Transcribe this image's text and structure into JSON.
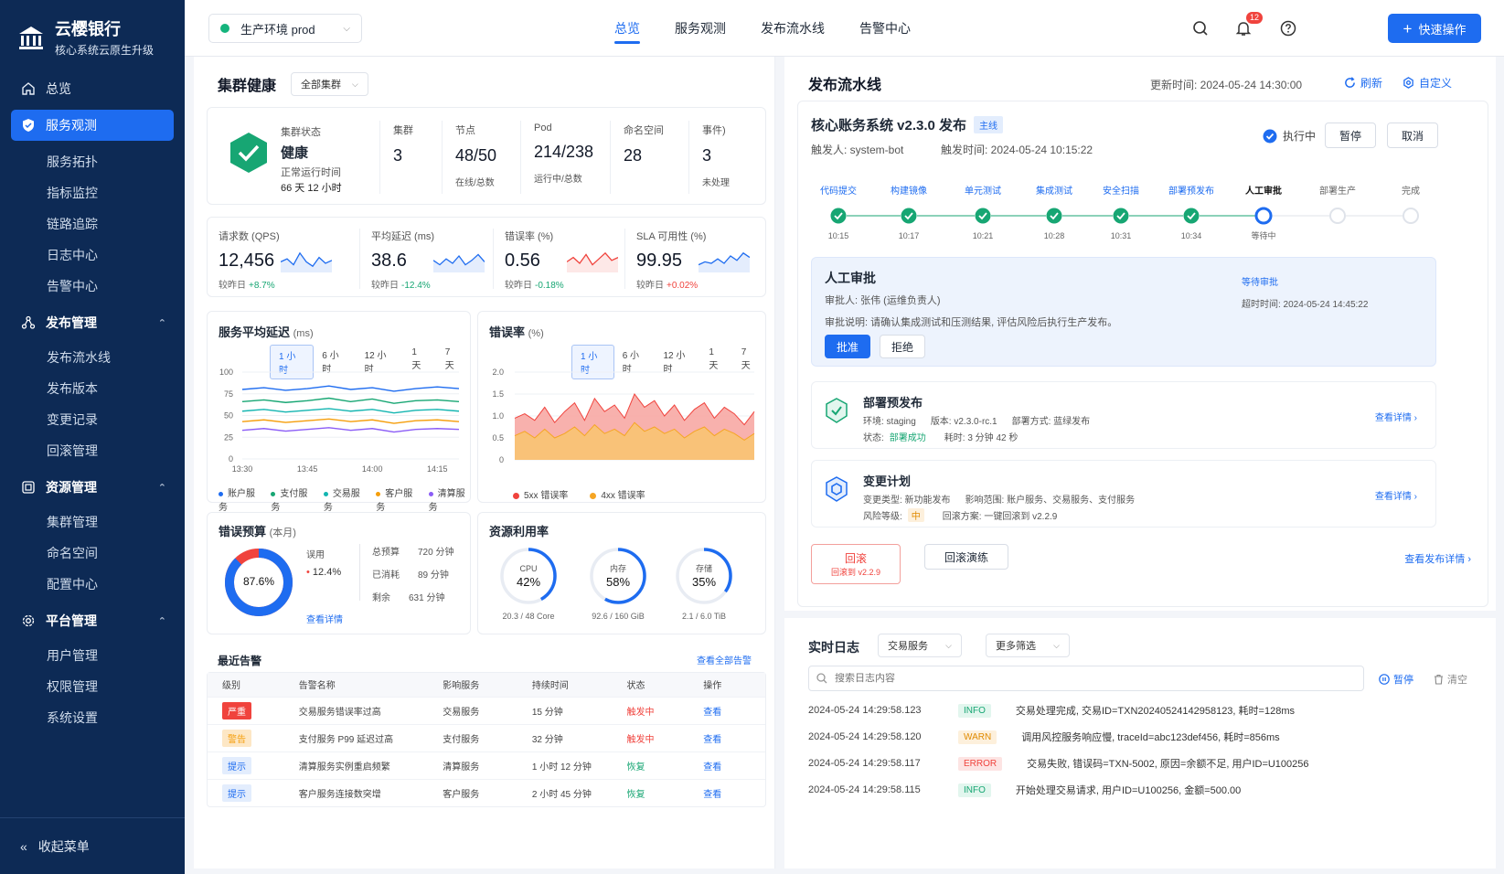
{
  "brand": {
    "name": "云樱银行",
    "sub": "核心系统云原生升级"
  },
  "sidebar": {
    "overview": "总览",
    "service_obs": "服务观测",
    "service_obs_items": [
      "服务拓扑",
      "指标监控",
      "链路追踪",
      "日志中心",
      "告警中心"
    ],
    "release": "发布管理",
    "release_items": [
      "发布流水线",
      "发布版本",
      "变更记录",
      "回滚管理"
    ],
    "resource": "资源管理",
    "resource_items": [
      "集群管理",
      "命名空间",
      "配置中心"
    ],
    "platform": "平台管理",
    "platform_items": [
      "用户管理",
      "权限管理",
      "系统设置"
    ],
    "collapse": "收起菜单"
  },
  "header": {
    "env": "生产环境 prod",
    "tabs": [
      "总览",
      "服务观测",
      "发布流水线",
      "告警中心"
    ],
    "notif_count": "12",
    "quick": "快速操作"
  },
  "cluster": {
    "title": "集群健康",
    "filter": "全部集群",
    "status_label": "集群状态",
    "status": "健康",
    "uptime_label": "正常运行时间",
    "uptime": "66 天 12 小时",
    "stats": [
      {
        "label": "集群",
        "value": "3",
        "sub": ""
      },
      {
        "label": "节点",
        "value": "48/50",
        "sub": "在线/总数"
      },
      {
        "label": "Pod",
        "value": "214/238",
        "sub": "运行中/总数"
      },
      {
        "label": "命名空间",
        "value": "28",
        "sub": ""
      },
      {
        "label": "事件)",
        "value": "3",
        "sub": "未处理"
      }
    ]
  },
  "kpis": [
    {
      "label": "请求数 (QPS)",
      "value": "12,456",
      "cmp": "较昨日",
      "delta": "+8.7%",
      "color": "#17a673",
      "spark": "#1e6cf0"
    },
    {
      "label": "平均延迟 (ms)",
      "value": "38.6",
      "cmp": "较昨日",
      "delta": "-12.4%",
      "color": "#17a673",
      "spark": "#1e6cf0"
    },
    {
      "label": "错误率 (%)",
      "value": "0.56",
      "cmp": "较昨日",
      "delta": "-0.18%",
      "color": "#17a673",
      "spark": "#f0433d"
    },
    {
      "label": "SLA 可用性 (%)",
      "value": "99.95",
      "cmp": "较昨日",
      "delta": "+0.02%",
      "color": "#f0433d",
      "spark": "#1e6cf0"
    }
  ],
  "latency": {
    "title": "服务平均延迟",
    "unit": "(ms)",
    "ranges": [
      "1 小时",
      "6 小时",
      "12 小时",
      "1 天",
      "7 天"
    ],
    "yticks": [
      "100",
      "75",
      "50",
      "25",
      "0"
    ],
    "xticks": [
      "13:30",
      "13:45",
      "14:00",
      "14:15"
    ],
    "legend": [
      {
        "name": "账户服务",
        "color": "#1e6cf0"
      },
      {
        "name": "支付服务",
        "color": "#17a673"
      },
      {
        "name": "交易服务",
        "color": "#13b5b1"
      },
      {
        "name": "客户服务",
        "color": "#f59e0b"
      },
      {
        "name": "清算服务",
        "color": "#8b5cf6"
      }
    ]
  },
  "chart_data": [
    {
      "type": "line",
      "title": "服务平均延迟 (ms)",
      "x": [
        "13:30",
        "13:35",
        "13:40",
        "13:45",
        "13:50",
        "13:55",
        "14:00",
        "14:05",
        "14:10",
        "14:15",
        "14:20"
      ],
      "ylim": [
        0,
        100
      ],
      "series": [
        {
          "name": "账户服务",
          "values": [
            80,
            82,
            79,
            81,
            84,
            80,
            82,
            78,
            81,
            83,
            81
          ]
        },
        {
          "name": "支付服务",
          "values": [
            66,
            68,
            65,
            67,
            70,
            66,
            69,
            64,
            67,
            68,
            66
          ]
        },
        {
          "name": "交易服务",
          "values": [
            55,
            57,
            54,
            56,
            58,
            55,
            57,
            53,
            56,
            57,
            55
          ]
        },
        {
          "name": "客户服务",
          "values": [
            43,
            45,
            42,
            44,
            46,
            43,
            45,
            41,
            44,
            45,
            43
          ]
        },
        {
          "name": "清算服务",
          "values": [
            33,
            35,
            32,
            34,
            36,
            33,
            35,
            31,
            34,
            35,
            34
          ]
        }
      ]
    },
    {
      "type": "area",
      "title": "错误率 (%)",
      "ylim": [
        0,
        2.0
      ],
      "series": [
        {
          "name": "5xx 错误率",
          "values": [
            0.95,
            1.05,
            0.9,
            1.2,
            0.85,
            1.1,
            1.3,
            0.9,
            1.4,
            1.1,
            1.25,
            0.95,
            1.5,
            1.2,
            1.35,
            1.0,
            1.25,
            0.9,
            1.15,
            1.3,
            0.95,
            1.2,
            1.05,
            0.8,
            1.1
          ]
        },
        {
          "name": "4xx 错误率",
          "values": [
            0.55,
            0.65,
            0.5,
            0.7,
            0.5,
            0.6,
            0.75,
            0.55,
            0.8,
            0.6,
            0.7,
            0.55,
            0.85,
            0.65,
            0.75,
            0.6,
            0.7,
            0.5,
            0.65,
            0.75,
            0.55,
            0.7,
            0.6,
            0.45,
            0.6
          ]
        }
      ]
    }
  ],
  "errrate": {
    "title": "错误率",
    "unit": "(%)",
    "ranges": [
      "1 小时",
      "6 小时",
      "12 小时",
      "1 天",
      "7 天"
    ],
    "yticks": [
      "2.0",
      "1.5",
      "1.0",
      "0.5",
      "0"
    ],
    "legend": [
      {
        "name": "5xx 错误率",
        "color": "#f0433d"
      },
      {
        "name": "4xx 错误率",
        "color": "#f5a524"
      }
    ]
  },
  "budget": {
    "title": "错误预算",
    "sub": "(本月)",
    "pct": "87.6%",
    "pct_value": 87.6,
    "used_label": "误用",
    "used": "12.4%",
    "rows": [
      {
        "k": "总预算",
        "v": "720 分钟"
      },
      {
        "k": "已消耗",
        "v": "89 分钟"
      },
      {
        "k": "剩余",
        "v": "631 分钟"
      }
    ],
    "link": "查看详情"
  },
  "resource": {
    "title": "资源利用率",
    "items": [
      {
        "name": "CPU",
        "value": "42%",
        "pct": 42,
        "sub": "20.3 / 48 Core"
      },
      {
        "name": "内存",
        "value": "58%",
        "pct": 58,
        "sub": "92.6 / 160 GiB"
      },
      {
        "name": "存储",
        "value": "35%",
        "pct": 35,
        "sub": "2.1 / 6.0 TiB"
      }
    ]
  },
  "alerts": {
    "title": "最近告警",
    "link": "查看全部告警",
    "headers": [
      "级别",
      "告警名称",
      "影响服务",
      "持续时间",
      "状态",
      "操作"
    ],
    "rows": [
      {
        "level": "严重",
        "lvcolor": "#f0433d",
        "lvtext": "#fff",
        "name": "交易服务错误率过高",
        "svc": "交易服务",
        "dur": "15 分钟",
        "status": "触发中",
        "stcolor": "#f0433d",
        "op": "查看"
      },
      {
        "level": "警告",
        "lvcolor": "#fde7c5",
        "lvtext": "#f59e0b",
        "name": "支付服务 P99 延迟过高",
        "svc": "支付服务",
        "dur": "32 分钟",
        "status": "触发中",
        "stcolor": "#f0433d",
        "op": "查看"
      },
      {
        "level": "提示",
        "lvcolor": "#e3edfd",
        "lvtext": "#1e6cf0",
        "name": "清算服务实例重启频繁",
        "svc": "清算服务",
        "dur": "1 小时 12 分钟",
        "status": "恢复",
        "stcolor": "#17a673",
        "op": "查看"
      },
      {
        "level": "提示",
        "lvcolor": "#e3edfd",
        "lvtext": "#1e6cf0",
        "name": "客户服务连接数突增",
        "svc": "客户服务",
        "dur": "2 小时 45 分钟",
        "status": "恢复",
        "stcolor": "#17a673",
        "op": "查看"
      }
    ]
  },
  "pipeline": {
    "title": "发布流水线",
    "updated": "更新时间: 2024-05-24 14:30:00",
    "refresh": "刷新",
    "custom": "自定义",
    "release": "核心账务系统 v2.3.0 发布",
    "branch": "主线",
    "trigger": "触发人: system-bot",
    "trigger_time": "触发时间: 2024-05-24 10:15:22",
    "running": "执行中",
    "pause": "暂停",
    "cancel": "取消",
    "stages": [
      {
        "name": "代码提交",
        "time": "10:15",
        "state": "done"
      },
      {
        "name": "构建镜像",
        "time": "10:17",
        "state": "done"
      },
      {
        "name": "单元测试",
        "time": "10:21",
        "state": "done"
      },
      {
        "name": "集成测试",
        "time": "10:28",
        "state": "done"
      },
      {
        "name": "安全扫描",
        "time": "10:31",
        "state": "done"
      },
      {
        "name": "部署预发布",
        "time": "10:34",
        "state": "done"
      },
      {
        "name": "人工审批",
        "time": "等待中",
        "state": "current"
      },
      {
        "name": "部署生产",
        "time": "",
        "state": "todo"
      },
      {
        "name": "完成",
        "time": "",
        "state": "todo"
      }
    ],
    "approval": {
      "title": "人工审批",
      "approver": "审批人: 张伟 (运维负责人)",
      "desc": "审批说明: 请确认集成测试和压测结果, 评估风险后执行生产发布。",
      "status": "等待审批",
      "timeout": "超时时间: 2024-05-24 14:45:22",
      "approve": "批准",
      "reject": "拒绝"
    },
    "deploy": {
      "title": "部署预发布",
      "env": "环境: staging",
      "ver": "版本: v2.3.0-rc.1",
      "mode": "部署方式: 蓝绿发布",
      "state_label": "状态:",
      "state": "部署成功",
      "cost": "耗时: 3 分钟 42 秒",
      "link": "查看详情"
    },
    "change": {
      "title": "变更计划",
      "type": "变更类型: 新功能发布",
      "scope": "影响范围: 账户服务、交易服务、支付服务",
      "risk_label": "风险等级:",
      "risk": "中",
      "rollback": "回滚方案: 一键回滚到 v2.2.9",
      "link": "查看详情"
    },
    "rollback": "回滚",
    "rollback_sub": "回滚到 v2.2.9",
    "drill": "回滚演练",
    "detail": "查看发布详情"
  },
  "logs": {
    "title": "实时日志",
    "svc": "交易服务",
    "filter": "更多筛选",
    "placeholder": "搜索日志内容",
    "pause": "暂停",
    "clear": "清空",
    "rows": [
      {
        "ts": "2024-05-24 14:29:58.123",
        "lvl": "INFO",
        "bg": "#e2f6ee",
        "fg": "#17a673",
        "msg": "交易处理完成, 交易ID=TXN20240524142958123, 耗时=128ms"
      },
      {
        "ts": "2024-05-24 14:29:58.120",
        "lvl": "WARN",
        "bg": "#fdf0dc",
        "fg": "#e08a00",
        "msg": "调用风控服务响应慢, traceId=abc123def456, 耗时=856ms"
      },
      {
        "ts": "2024-05-24 14:29:58.117",
        "lvl": "ERROR",
        "bg": "#fde4e3",
        "fg": "#f0433d",
        "msg": "交易失败, 错误码=TXN-5002, 原因=余额不足, 用户ID=U100256"
      },
      {
        "ts": "2024-05-24 14:29:58.115",
        "lvl": "INFO",
        "bg": "#e2f6ee",
        "fg": "#17a673",
        "msg": "开始处理交易请求, 用户ID=U100256, 金额=500.00"
      }
    ]
  }
}
